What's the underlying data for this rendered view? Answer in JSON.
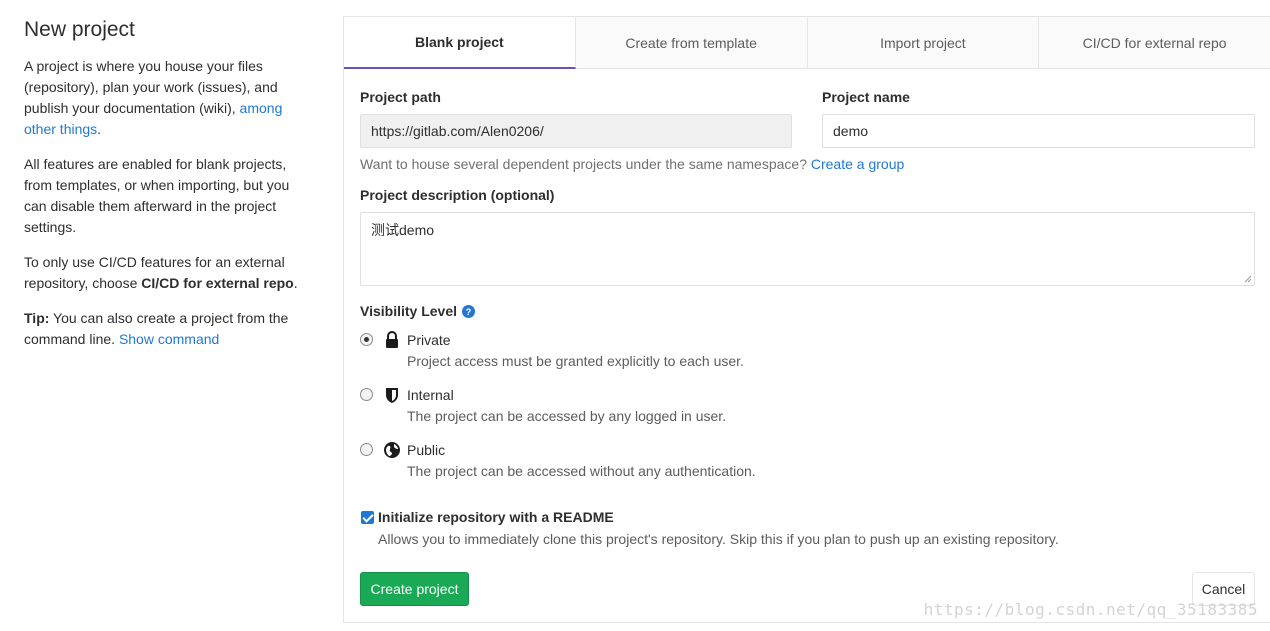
{
  "sidebar": {
    "title": "New project",
    "p1_text": "A project is where you house your files (repository), plan your work (issues), and publish your documentation (wiki), ",
    "p1_link": "among other things",
    "p1_end": ".",
    "p2": "All features are enabled for blank projects, from templates, or when importing, but you can disable them afterward in the project settings.",
    "p3_text": "To only use CI/CD features for an external repository, choose ",
    "p3_bold": "CI/CD for external repo",
    "p3_end": ".",
    "tip_label": "Tip:",
    "tip_text": " You can also create a project from the command line. ",
    "tip_link": "Show command"
  },
  "tabs": [
    {
      "label": "Blank project",
      "active": true
    },
    {
      "label": "Create from template",
      "active": false
    },
    {
      "label": "Import project",
      "active": false
    },
    {
      "label": "CI/CD for external repo",
      "active": false
    }
  ],
  "form": {
    "path_label": "Project path",
    "path_value": "https://gitlab.com/Alen0206/",
    "name_label": "Project name",
    "name_value": "demo",
    "namespace_help": "Want to house several dependent projects under the same namespace? ",
    "namespace_link": "Create a group",
    "desc_label": "Project description (optional)",
    "desc_value": "测试demo",
    "visibility_label": "Visibility Level",
    "visibility_options": [
      {
        "title": "Private",
        "desc": "Project access must be granted explicitly to each user.",
        "checked": true,
        "icon": "lock-icon"
      },
      {
        "title": "Internal",
        "desc": "The project can be accessed by any logged in user.",
        "checked": false,
        "icon": "shield-icon"
      },
      {
        "title": "Public",
        "desc": "The project can be accessed without any authentication.",
        "checked": false,
        "icon": "globe-icon"
      }
    ],
    "readme_label": "Initialize repository with a README",
    "readme_desc": "Allows you to immediately clone this project's repository. Skip this if you plan to push up an existing repository.",
    "readme_checked": true,
    "create_button": "Create project",
    "cancel_button": "Cancel"
  },
  "watermark": "https://blog.csdn.net/qq_35183385",
  "colors": {
    "primary_link": "#1f78d1",
    "success": "#1aaa55",
    "active_tab_underline": "#6b4fbb"
  }
}
